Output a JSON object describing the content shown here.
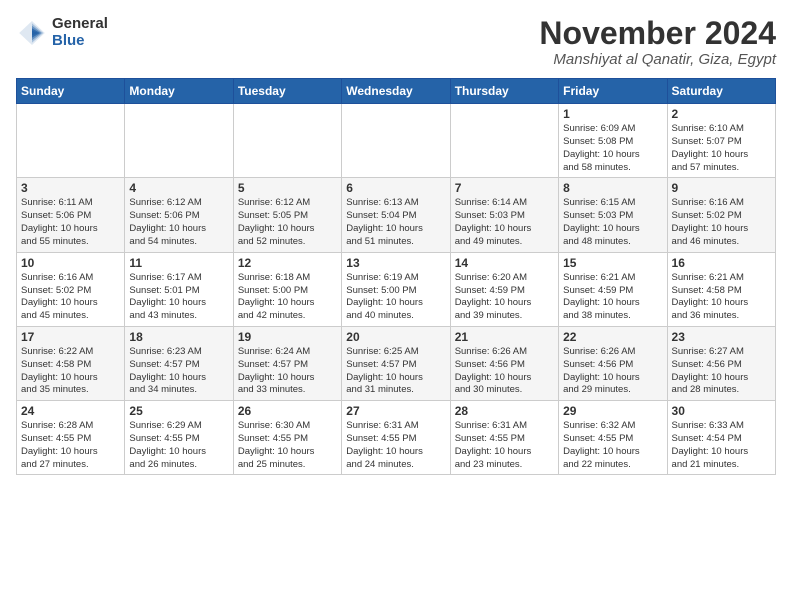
{
  "logo": {
    "general": "General",
    "blue": "Blue"
  },
  "header": {
    "month": "November 2024",
    "location": "Manshiyat al Qanatir, Giza, Egypt"
  },
  "weekdays": [
    "Sunday",
    "Monday",
    "Tuesday",
    "Wednesday",
    "Thursday",
    "Friday",
    "Saturday"
  ],
  "weeks": [
    [
      {
        "day": "",
        "info": ""
      },
      {
        "day": "",
        "info": ""
      },
      {
        "day": "",
        "info": ""
      },
      {
        "day": "",
        "info": ""
      },
      {
        "day": "",
        "info": ""
      },
      {
        "day": "1",
        "info": "Sunrise: 6:09 AM\nSunset: 5:08 PM\nDaylight: 10 hours\nand 58 minutes."
      },
      {
        "day": "2",
        "info": "Sunrise: 6:10 AM\nSunset: 5:07 PM\nDaylight: 10 hours\nand 57 minutes."
      }
    ],
    [
      {
        "day": "3",
        "info": "Sunrise: 6:11 AM\nSunset: 5:06 PM\nDaylight: 10 hours\nand 55 minutes."
      },
      {
        "day": "4",
        "info": "Sunrise: 6:12 AM\nSunset: 5:06 PM\nDaylight: 10 hours\nand 54 minutes."
      },
      {
        "day": "5",
        "info": "Sunrise: 6:12 AM\nSunset: 5:05 PM\nDaylight: 10 hours\nand 52 minutes."
      },
      {
        "day": "6",
        "info": "Sunrise: 6:13 AM\nSunset: 5:04 PM\nDaylight: 10 hours\nand 51 minutes."
      },
      {
        "day": "7",
        "info": "Sunrise: 6:14 AM\nSunset: 5:03 PM\nDaylight: 10 hours\nand 49 minutes."
      },
      {
        "day": "8",
        "info": "Sunrise: 6:15 AM\nSunset: 5:03 PM\nDaylight: 10 hours\nand 48 minutes."
      },
      {
        "day": "9",
        "info": "Sunrise: 6:16 AM\nSunset: 5:02 PM\nDaylight: 10 hours\nand 46 minutes."
      }
    ],
    [
      {
        "day": "10",
        "info": "Sunrise: 6:16 AM\nSunset: 5:02 PM\nDaylight: 10 hours\nand 45 minutes."
      },
      {
        "day": "11",
        "info": "Sunrise: 6:17 AM\nSunset: 5:01 PM\nDaylight: 10 hours\nand 43 minutes."
      },
      {
        "day": "12",
        "info": "Sunrise: 6:18 AM\nSunset: 5:00 PM\nDaylight: 10 hours\nand 42 minutes."
      },
      {
        "day": "13",
        "info": "Sunrise: 6:19 AM\nSunset: 5:00 PM\nDaylight: 10 hours\nand 40 minutes."
      },
      {
        "day": "14",
        "info": "Sunrise: 6:20 AM\nSunset: 4:59 PM\nDaylight: 10 hours\nand 39 minutes."
      },
      {
        "day": "15",
        "info": "Sunrise: 6:21 AM\nSunset: 4:59 PM\nDaylight: 10 hours\nand 38 minutes."
      },
      {
        "day": "16",
        "info": "Sunrise: 6:21 AM\nSunset: 4:58 PM\nDaylight: 10 hours\nand 36 minutes."
      }
    ],
    [
      {
        "day": "17",
        "info": "Sunrise: 6:22 AM\nSunset: 4:58 PM\nDaylight: 10 hours\nand 35 minutes."
      },
      {
        "day": "18",
        "info": "Sunrise: 6:23 AM\nSunset: 4:57 PM\nDaylight: 10 hours\nand 34 minutes."
      },
      {
        "day": "19",
        "info": "Sunrise: 6:24 AM\nSunset: 4:57 PM\nDaylight: 10 hours\nand 33 minutes."
      },
      {
        "day": "20",
        "info": "Sunrise: 6:25 AM\nSunset: 4:57 PM\nDaylight: 10 hours\nand 31 minutes."
      },
      {
        "day": "21",
        "info": "Sunrise: 6:26 AM\nSunset: 4:56 PM\nDaylight: 10 hours\nand 30 minutes."
      },
      {
        "day": "22",
        "info": "Sunrise: 6:26 AM\nSunset: 4:56 PM\nDaylight: 10 hours\nand 29 minutes."
      },
      {
        "day": "23",
        "info": "Sunrise: 6:27 AM\nSunset: 4:56 PM\nDaylight: 10 hours\nand 28 minutes."
      }
    ],
    [
      {
        "day": "24",
        "info": "Sunrise: 6:28 AM\nSunset: 4:55 PM\nDaylight: 10 hours\nand 27 minutes."
      },
      {
        "day": "25",
        "info": "Sunrise: 6:29 AM\nSunset: 4:55 PM\nDaylight: 10 hours\nand 26 minutes."
      },
      {
        "day": "26",
        "info": "Sunrise: 6:30 AM\nSunset: 4:55 PM\nDaylight: 10 hours\nand 25 minutes."
      },
      {
        "day": "27",
        "info": "Sunrise: 6:31 AM\nSunset: 4:55 PM\nDaylight: 10 hours\nand 24 minutes."
      },
      {
        "day": "28",
        "info": "Sunrise: 6:31 AM\nSunset: 4:55 PM\nDaylight: 10 hours\nand 23 minutes."
      },
      {
        "day": "29",
        "info": "Sunrise: 6:32 AM\nSunset: 4:55 PM\nDaylight: 10 hours\nand 22 minutes."
      },
      {
        "day": "30",
        "info": "Sunrise: 6:33 AM\nSunset: 4:54 PM\nDaylight: 10 hours\nand 21 minutes."
      }
    ]
  ]
}
